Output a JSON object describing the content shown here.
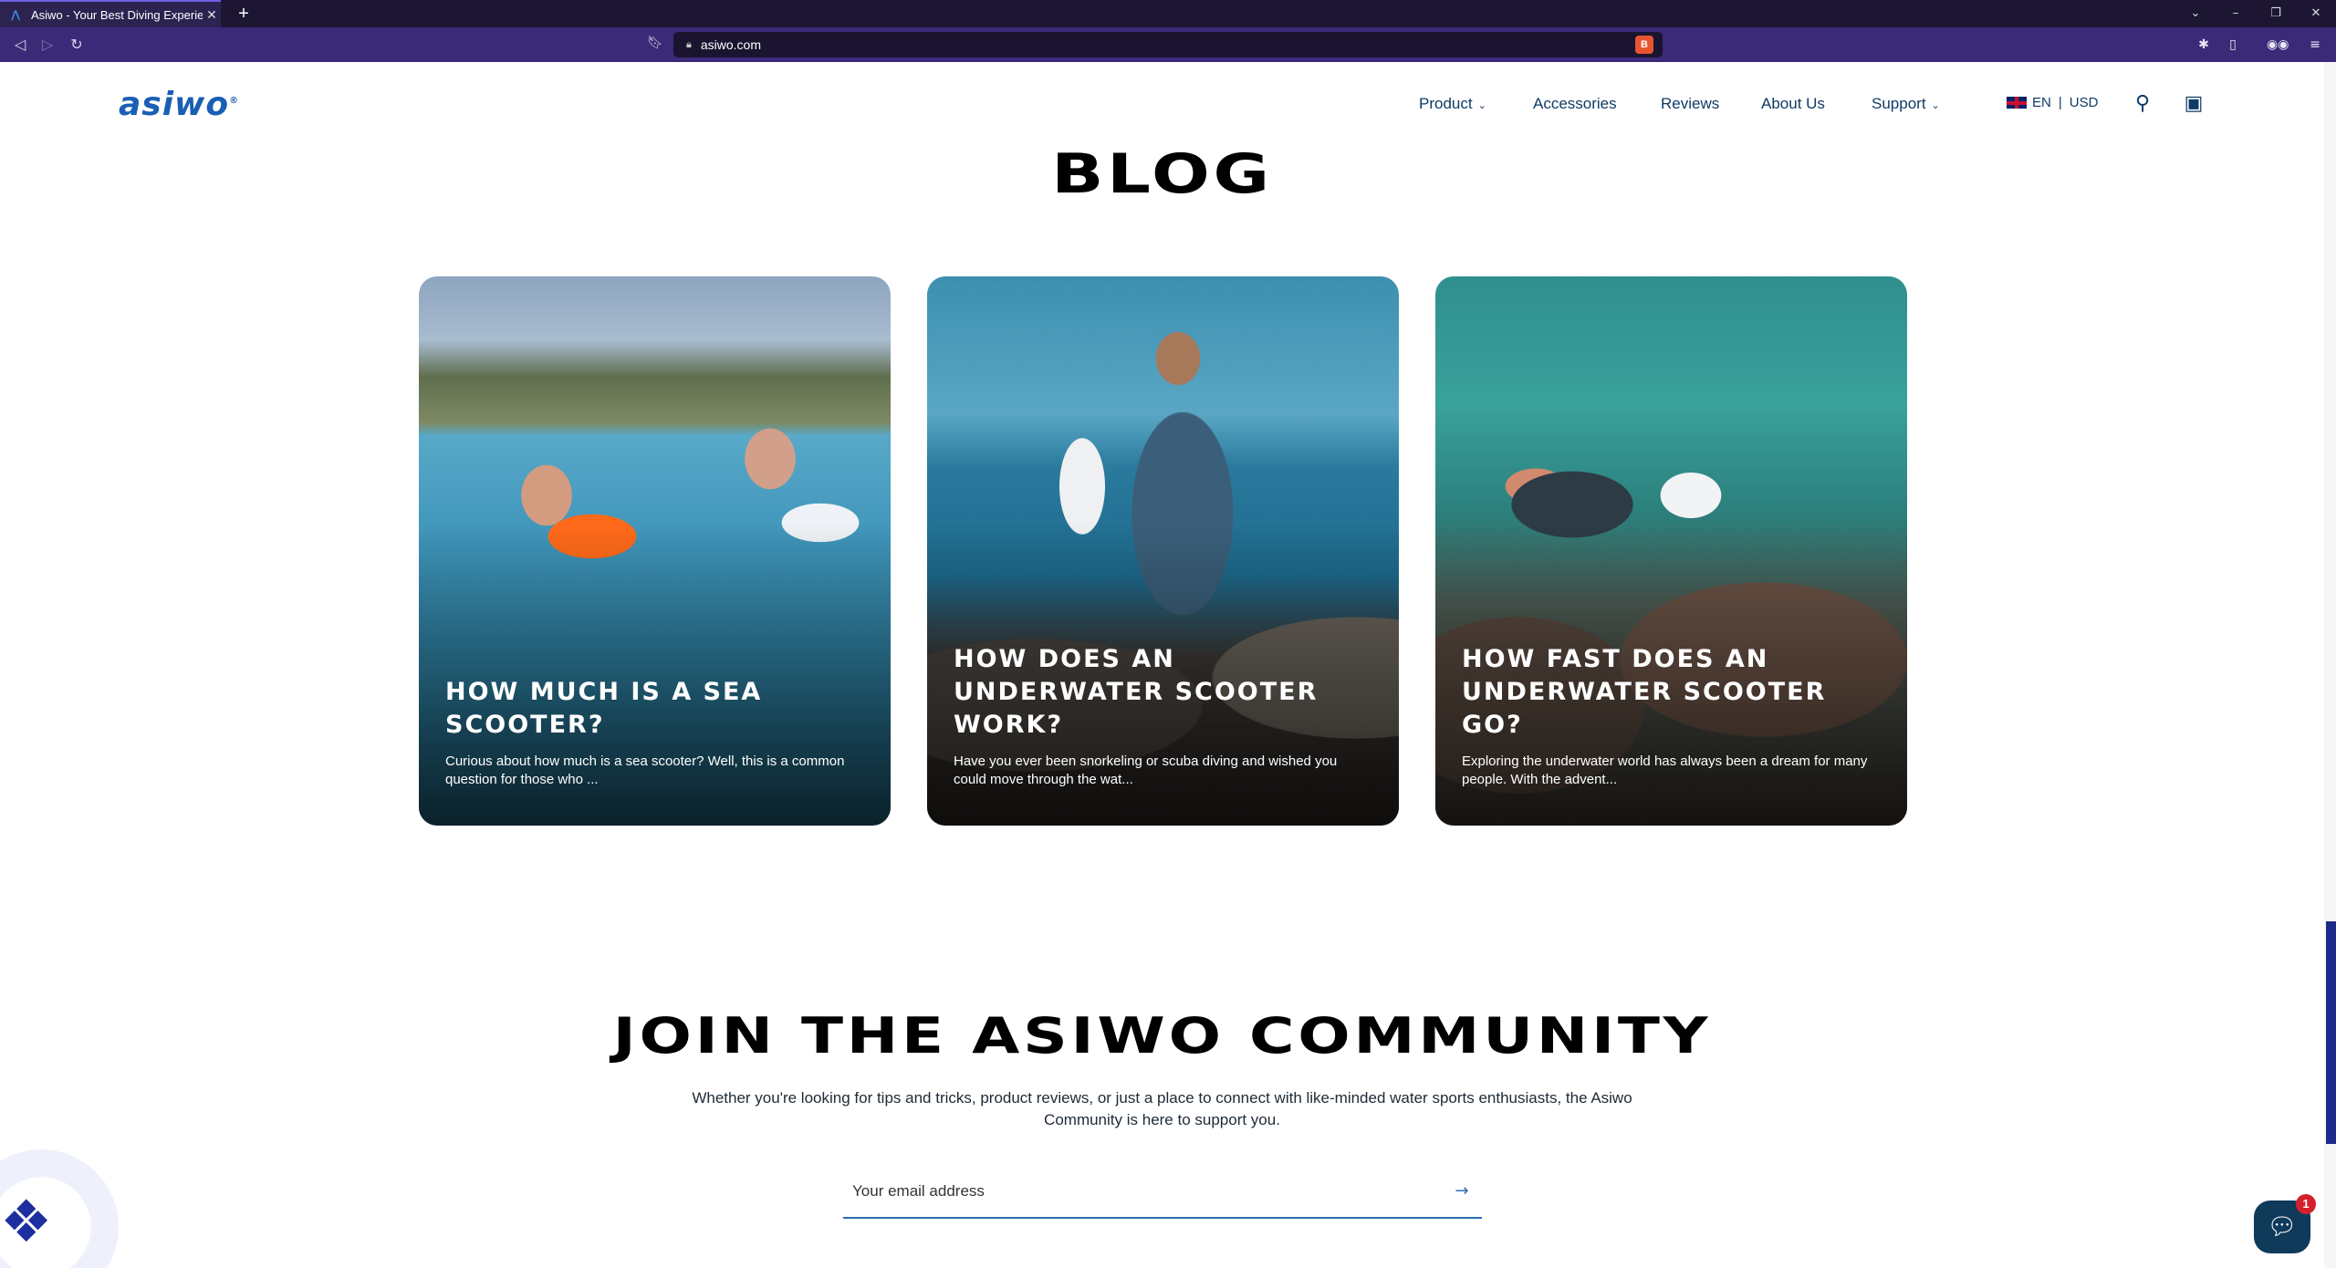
{
  "browser": {
    "tab_title": "Asiwo - Your Best Diving Experien",
    "url": "asiwo.com"
  },
  "header": {
    "logo_text": "asiwo",
    "nav": {
      "product": "Product",
      "accessories": "Accessories",
      "reviews": "Reviews",
      "about": "About Us",
      "support": "Support"
    },
    "language": "EN",
    "currency": "USD"
  },
  "blog": {
    "title": "BLOG",
    "posts": [
      {
        "title": "HOW MUCH IS A SEA SCOOTER?",
        "excerpt": "Curious about how much is a sea scooter? Well, this is a common question for those who ..."
      },
      {
        "title": "HOW DOES AN UNDERWATER SCOOTER WORK?",
        "excerpt": "Have you ever been snorkeling or scuba diving and wished you could move through the wat..."
      },
      {
        "title": "HOW FAST DOES AN UNDERWATER SCOOTER GO?",
        "excerpt": "Exploring the underwater world has always been a dream for many people. With the advent..."
      }
    ]
  },
  "community": {
    "title": "JOIN THE ASIWO COMMUNITY",
    "text": "Whether you're looking for tips and tricks, product reviews, or just a place to connect with like-minded water sports enthusiasts, the Asiwo Community is here to support you.",
    "email_placeholder": "Your email address"
  },
  "chat": {
    "badge_count": "1"
  },
  "colors": {
    "brand_blue": "#1a5fb4",
    "nav_text": "#0f3b66",
    "browser_toolbar": "#3a2a78"
  }
}
